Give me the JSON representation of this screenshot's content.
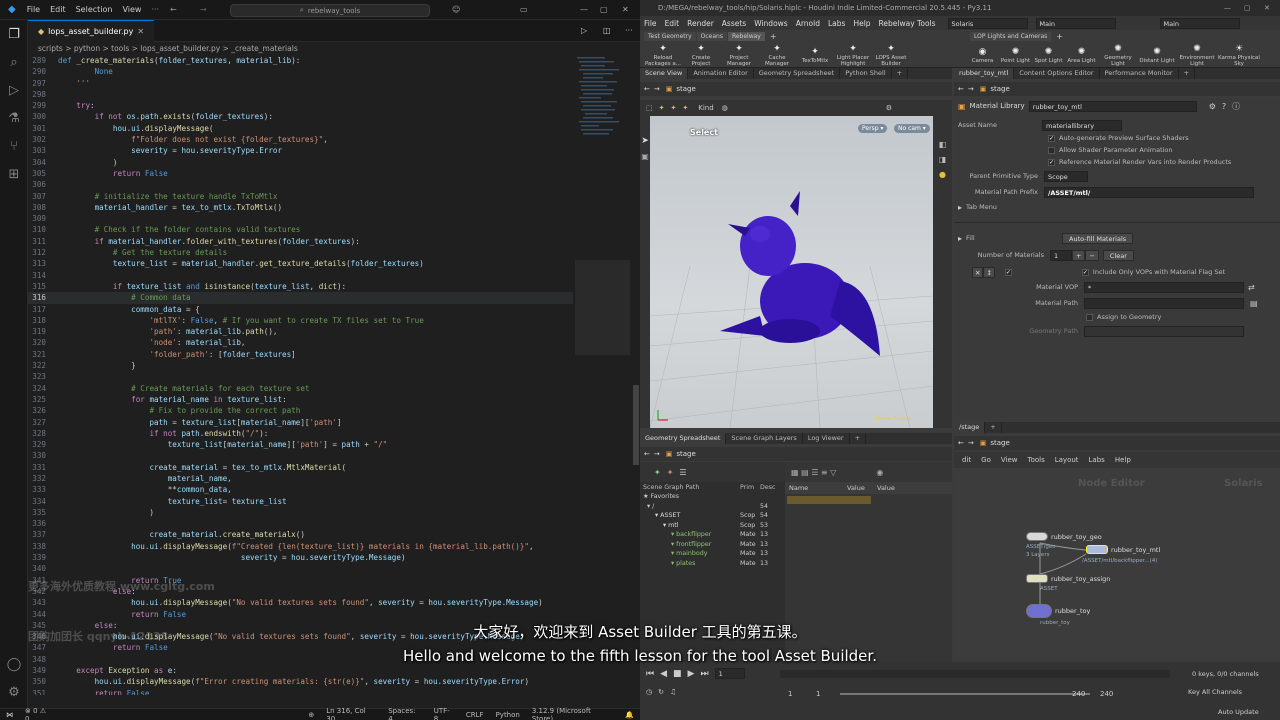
{
  "vscode": {
    "menu": [
      "File",
      "Edit",
      "Selection",
      "View"
    ],
    "search": "rebelway_tools",
    "tab": "lops_asset_builder.py",
    "breadcrumb": "scripts > python > tools > lops_asset_builder.py > _create_materials",
    "status": {
      "left": "⊗ 0 ⚠ 0",
      "pos": "Ln 316, Col 30",
      "spaces": "Spaces: 4",
      "enc": "UTF-8",
      "eol": "CRLF",
      "lang": "Python",
      "ver": "3.12.9 (Microsoft Store)"
    },
    "lines": [
      {
        "n": "289",
        "h": "<span class='bl'>def</span> <span class='fn'>_create_materials</span>(<span class='vr'>folder_textures</span>, <span class='vr'>material_lib</span>):"
      },
      {
        "n": "290",
        "h": "        <span class='bl'>None</span>"
      },
      {
        "n": "297",
        "h": "    <span class='st'>'''</span>"
      },
      {
        "n": "298",
        "h": ""
      },
      {
        "n": "299",
        "h": "    <span class='kw'>try</span>:"
      },
      {
        "n": "300",
        "h": "        <span class='kw'>if not</span> <span class='vr'>os</span>.<span class='vr'>path</span>.<span class='fn'>exists</span>(<span class='vr'>folder_textures</span>):"
      },
      {
        "n": "301",
        "h": "            <span class='vr'>hou</span>.<span class='vr'>ui</span>.<span class='fn'>displayMessage</span>("
      },
      {
        "n": "302",
        "h": "                <span class='st'>f\"Folder does not exist {folder_textures}\"</span>,"
      },
      {
        "n": "303",
        "h": "                <span class='vr'>severity</span> = <span class='vr'>hou</span>.<span class='vr'>severityType</span>.<span class='vr'>Error</span>"
      },
      {
        "n": "304",
        "h": "            )"
      },
      {
        "n": "305",
        "h": "            <span class='kw'>return</span> <span class='bl'>False</span>"
      },
      {
        "n": "306",
        "h": ""
      },
      {
        "n": "307",
        "h": "        <span class='cm'># initialize the texture handle TxToMtlx</span>"
      },
      {
        "n": "308",
        "h": "        <span class='vr'>material_handler</span> = <span class='vr'>tex_to_mtlx</span>.<span class='fn'>TxToMtlx</span>()"
      },
      {
        "n": "309",
        "h": ""
      },
      {
        "n": "310",
        "h": "        <span class='cm'># Check if the folder contains valid textures</span>"
      },
      {
        "n": "311",
        "h": "        <span class='kw'>if</span> <span class='vr'>material_handler</span>.<span class='fn'>folder_with_textures</span>(<span class='vr'>folder_textures</span>):"
      },
      {
        "n": "312",
        "h": "            <span class='cm'># Get the texture details</span>"
      },
      {
        "n": "313",
        "h": "            <span class='vr'>texture_list</span> = <span class='vr'>material_handler</span>.<span class='fn'>get_texture_details</span>(<span class='vr'>folder_textures</span>)"
      },
      {
        "n": "314",
        "h": ""
      },
      {
        "n": "315",
        "h": "            <span class='kw'>if</span> <span class='vr'>texture_list</span> <span class='bl'>and</span> <span class='fn'>isinstance</span>(<span class='vr'>texture_list</span>, <span class='fn'>dict</span>):"
      },
      {
        "n": "316",
        "h": "                <span class='cm'># Common data</span>"
      },
      {
        "n": "317",
        "h": "                <span class='vr'>common_data</span> = {"
      },
      {
        "n": "318",
        "h": "                    <span class='st'>'mtlTX'</span>: <span class='bl'>False</span>, <span class='cm'># If you want to create TX files set to True</span>"
      },
      {
        "n": "319",
        "h": "                    <span class='st'>'path'</span>: <span class='vr'>material_lib</span>.<span class='fn'>path</span>(),"
      },
      {
        "n": "320",
        "h": "                    <span class='st'>'node'</span>: <span class='vr'>material_lib</span>,"
      },
      {
        "n": "321",
        "h": "                    <span class='st'>'folder_path'</span>: [<span class='vr'>folder_textures</span>]"
      },
      {
        "n": "322",
        "h": "                }"
      },
      {
        "n": "323",
        "h": ""
      },
      {
        "n": "324",
        "h": "                <span class='cm'># Create materials for each texture set</span>"
      },
      {
        "n": "325",
        "h": "                <span class='kw'>for</span> <span class='vr'>material_name</span> <span class='kw'>in</span> <span class='vr'>texture_list</span>:"
      },
      {
        "n": "326",
        "h": "                    <span class='cm'># Fix to provide the correct path</span>"
      },
      {
        "n": "327",
        "h": "                    <span class='vr'>path</span> = <span class='vr'>texture_list</span>[<span class='vr'>material_name</span>][<span class='st'>'path'</span>]"
      },
      {
        "n": "328",
        "h": "                    <span class='kw'>if not</span> <span class='vr'>path</span>.<span class='fn'>endswith</span>(<span class='st'>\"/\"</span>):"
      },
      {
        "n": "329",
        "h": "                        <span class='vr'>texture_list</span>[<span class='vr'>material_name</span>][<span class='st'>'path'</span>] = <span class='vr'>path</span> + <span class='st'>\"/\"</span>"
      },
      {
        "n": "330",
        "h": ""
      },
      {
        "n": "331",
        "h": "                    <span class='vr'>create_material</span> = <span class='vr'>tex_to_mtlx</span>.<span class='fn'>MtlxMaterial</span>("
      },
      {
        "n": "332",
        "h": "                        <span class='vr'>material_name</span>,"
      },
      {
        "n": "333",
        "h": "                        **<span class='vr'>common_data</span>,"
      },
      {
        "n": "334",
        "h": "                        <span class='vr'>texture_list</span>= <span class='vr'>texture_list</span>"
      },
      {
        "n": "335",
        "h": "                    )"
      },
      {
        "n": "336",
        "h": ""
      },
      {
        "n": "337",
        "h": "                    <span class='vr'>create_material</span>.<span class='fn'>create_materialx</span>()"
      },
      {
        "n": "338",
        "h": "                <span class='vr'>hou</span>.<span class='vr'>ui</span>.<span class='fn'>displayMessage</span>(<span class='st'>f\"Created {len(texture_list)} materials in {material_lib.path()}\"</span>,"
      },
      {
        "n": "339",
        "h": "                                        <span class='vr'>severity</span> = <span class='vr'>hou</span>.<span class='vr'>severityType</span>.<span class='vr'>Message</span>)"
      },
      {
        "n": "340",
        "h": ""
      },
      {
        "n": "341",
        "h": "                <span class='kw'>return</span> <span class='bl'>True</span>"
      },
      {
        "n": "342",
        "h": "            <span class='kw'>else</span>:"
      },
      {
        "n": "343",
        "h": "                <span class='vr'>hou</span>.<span class='vr'>ui</span>.<span class='fn'>displayMessage</span>(<span class='st'>\"No valid textures sets found\"</span>, <span class='vr'>severity</span> = <span class='vr'>hou</span>.<span class='vr'>severityType</span>.<span class='vr'>Message</span>)"
      },
      {
        "n": "344",
        "h": "                <span class='kw'>return</span> <span class='bl'>False</span>"
      },
      {
        "n": "345",
        "h": "        <span class='kw'>else</span>:"
      },
      {
        "n": "346",
        "h": "            <span class='vr'>hou</span>.<span class='vr'>ui</span>.<span class='fn'>displayMessage</span>(<span class='st'>\"No valid textures sets found\"</span>, <span class='vr'>severity</span> = <span class='vr'>hou</span>.<span class='vr'>severityType</span>.<span class='vr'>Message</span>)"
      },
      {
        "n": "347",
        "h": "            <span class='kw'>return</span> <span class='bl'>False</span>"
      },
      {
        "n": "348",
        "h": ""
      },
      {
        "n": "349",
        "h": "    <span class='kw'>except</span> <span class='fn'>Exception</span> <span class='kw'>as</span> <span class='vr'>e</span>:"
      },
      {
        "n": "350",
        "h": "        <span class='vr'>hou</span>.<span class='vr'>ui</span>.<span class='fn'>displayMessage</span>(<span class='st'>f\"Error creating materials: {str(e)}\"</span>, <span class='vr'>severity</span> = <span class='vr'>hou</span>.<span class='vr'>severityType</span>.<span class='vr'>Error</span>)"
      },
      {
        "n": "351",
        "h": "        <span class='kw'>return</span> <span class='bl'>False</span>"
      }
    ],
    "watermark1": "更多海外优质教程 www.cgltg.com",
    "watermark2": "团购加团长 qqnyb-12138"
  },
  "houdini": {
    "title": "D:/MEGA/rebelway_tools/hip/Solaris.hiplc - Houdini Indie Limited-Commercial 20.5.445 - Py3.11",
    "menu": [
      "File",
      "Edit",
      "Render",
      "Assets",
      "Windows",
      "Arnold",
      "Labs",
      "Help",
      "Rebelway Tools"
    ],
    "desktop": "Solaris",
    "context": "Main",
    "context2": "Main",
    "shelf_tabs": [
      "Test Geometry",
      "Oceans",
      "Rebelway"
    ],
    "shelf_tools": [
      "Reload Packages a...",
      "Create Project",
      "Project Manager",
      "Cache Manager",
      "TexToMtlx",
      "Light Placer Highlight",
      "LOPS Asset Builder"
    ],
    "shelf2_tabs": [
      "LOP Lights and Cameras"
    ],
    "shelf2_tools": [
      "Camera",
      "Point Light",
      "Spot Light",
      "Area Light",
      "Geometry Light",
      "Distant Light",
      "Environment Light",
      "Karma Physical Sky"
    ],
    "vp_tabs": [
      "Scene View",
      "Animation Editor",
      "Geometry Spreadsheet",
      "Python Shell"
    ],
    "vp_path": "stage",
    "vp_kind": "Kind",
    "select_label": "Select",
    "persp": "Persp ▾",
    "nocam": "No cam ▾",
    "vp_bottom": "Karma Engine",
    "param_tabs": [
      "rubber_toy_mtl",
      "Content Options Editor",
      "Performance Monitor"
    ],
    "param_path": "stage",
    "node_type": "Material Library",
    "node_name": "rubber_toy_mtl",
    "asset_name_label": "Asset Name",
    "asset_name_value": "materiallibrary",
    "checks": [
      "Auto-generate Preview Surface Shaders",
      "Allow Shader Parameter Animation",
      "Reference Material Render Vars into Render Products"
    ],
    "prim_type_label": "Parent Primitive Type",
    "prim_type_value": "Scope",
    "mat_prefix_label": "Material Path Prefix",
    "mat_prefix_value": "/ASSET/mtl/",
    "tab_menu": "Tab Menu",
    "fill_label": "Fill",
    "autofill": "Auto-fill Materials",
    "num_mat_label": "Number of Materials",
    "num_mat_value": "1",
    "clear": "Clear",
    "include_vop": "Include Only VOPs with Material Flag Set",
    "mat_vop_label": "Material VOP",
    "mat_vop_value": "*",
    "mat_path_label": "Material Path",
    "assign_geo": "Assign to Geometry",
    "geo_path_label": "Geometry Path",
    "sg_tabs": [
      "Geometry Spreadsheet",
      "Scene Graph Layers",
      "Log Viewer"
    ],
    "sg_path": "stage",
    "sg_cols": [
      "Scene Graph Path",
      "Prim",
      "Desc"
    ],
    "sg_rows": [
      [
        "Favorites",
        "",
        ""
      ],
      [
        "/",
        "",
        "54"
      ],
      [
        "ASSET",
        "Scop",
        "54"
      ],
      [
        "mtl",
        "Scop",
        "53"
      ],
      [
        "backflipper",
        "Mate",
        "13"
      ],
      [
        "frontflipper",
        "Mate",
        "13"
      ],
      [
        "mainbody",
        "Mate",
        "13"
      ],
      [
        "plates",
        "Mate",
        "13"
      ]
    ],
    "attr_cols": [
      "Name",
      "Value"
    ],
    "value_label": "Value",
    "ne_tabs": [
      "/stage"
    ],
    "ne_path": "stage",
    "ne_menu": [
      "dit",
      "Go",
      "View",
      "Tools",
      "Layout",
      "Labs",
      "Help"
    ],
    "ne_label1": "Node Editor",
    "ne_label2": "Solaris",
    "nodes": [
      {
        "name": "rubber_toy_geo",
        "sub": "ASSET/geo",
        "sub2": "3 Layers",
        "color": "#d8d8d8"
      },
      {
        "name": "rubber_toy_mtl",
        "sub": "/ASSET/mtl/backflipper...(4)",
        "color": "#b0b8e0"
      },
      {
        "name": "rubber_toy_assign",
        "sub": "ASSET",
        "color": "#e0e0c0"
      },
      {
        "name": "rubber_toy",
        "sub": "rubber_toy",
        "color": "#7070d0"
      }
    ],
    "timeline": {
      "frame": "1",
      "start": "1",
      "end": "240",
      "end2": "240",
      "keys": "0 keys, 0/0 channels",
      "keyall": "Key All Channels",
      "auto": "Auto Update"
    }
  },
  "subtitle": {
    "zh": "大家好，欢迎来到 Asset Builder 工具的第五课。",
    "en": "Hello and welcome to the fifth lesson for the tool Asset Builder."
  }
}
